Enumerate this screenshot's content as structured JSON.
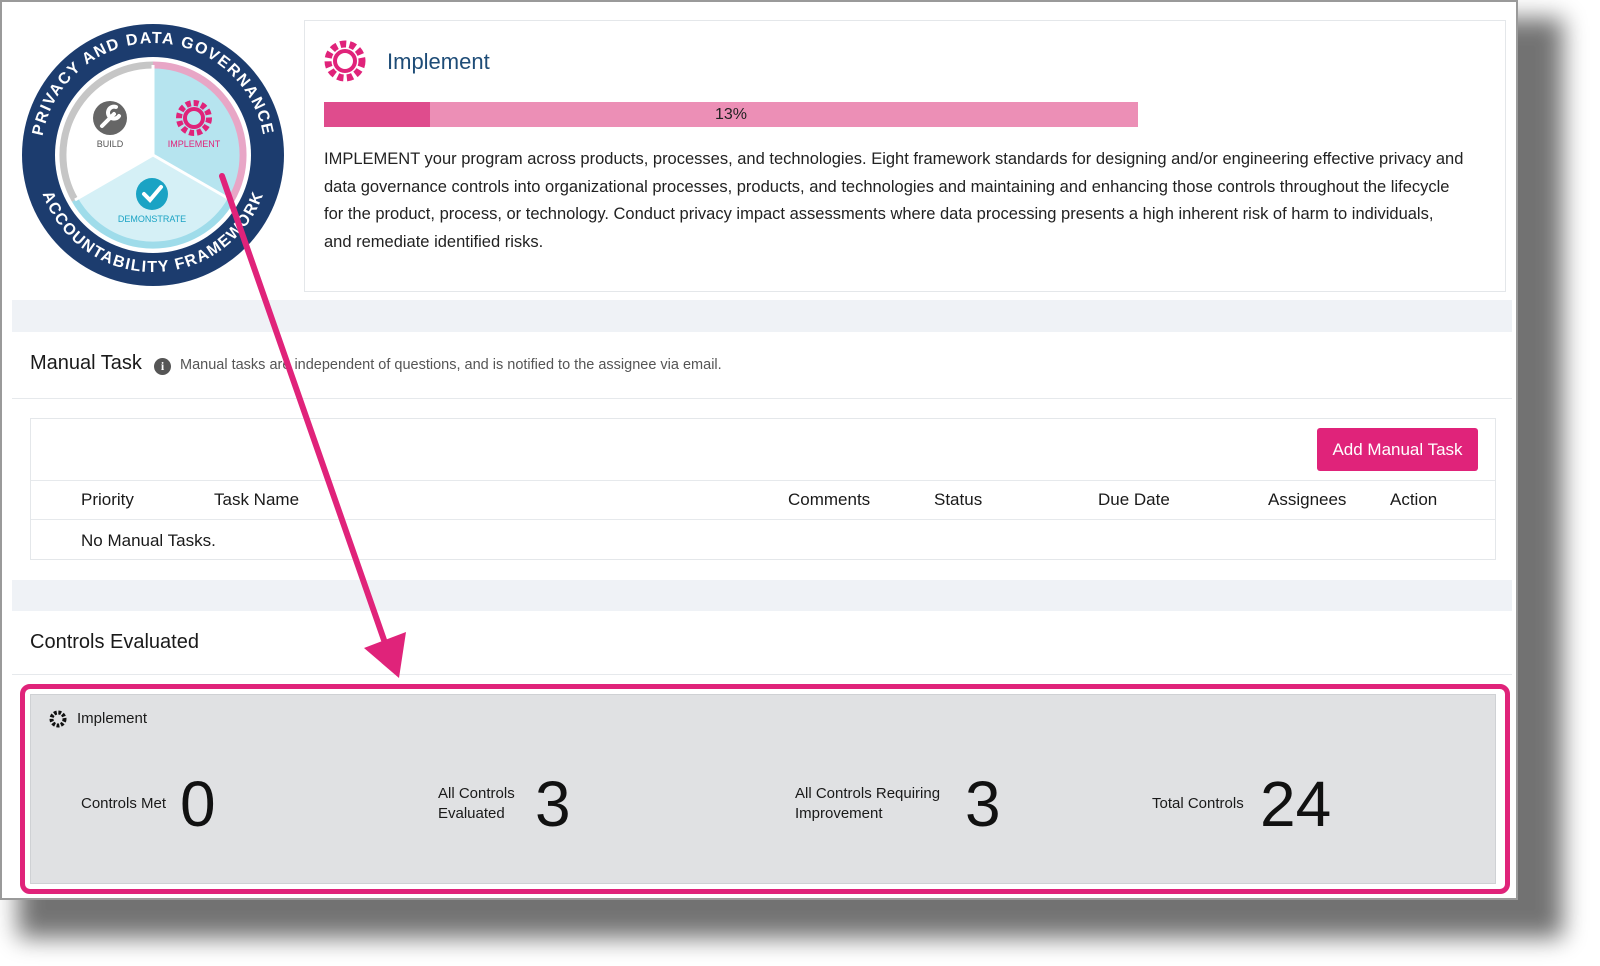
{
  "logo": {
    "ring_top": "PRIVACY AND DATA GOVERNANCE",
    "ring_bottom": "ACCOUNTABILITY FRAMEWORK",
    "segments": [
      "BUILD",
      "IMPLEMENT",
      "DEMONSTRATE"
    ]
  },
  "phase": {
    "title": "Implement",
    "progress": 0.13,
    "progress_label": "13%",
    "description": "IMPLEMENT your program across products, processes, and technologies. Eight framework standards for designing and/or engineering effective privacy and data governance controls into organizational processes, products, and technologies and maintaining and enhancing those controls throughout the lifecycle for the product, process, or technology. Conduct privacy impact assessments where data processing presents a high inherent risk of harm to individuals, and remediate identified risks."
  },
  "manual_task": {
    "title": "Manual Task",
    "hint": "Manual tasks are independent of questions, and is notified to the assignee via email.",
    "add_button": "Add Manual Task",
    "columns": [
      "Priority",
      "Task Name",
      "Comments",
      "Status",
      "Due Date",
      "Assignees",
      "Action"
    ],
    "empty_text": "No Manual Tasks."
  },
  "controls": {
    "title": "Controls Evaluated",
    "group_label": "Implement",
    "stats": [
      {
        "label": "Controls Met",
        "value": "0"
      },
      {
        "label": "All Controls Evaluated",
        "value": "3"
      },
      {
        "label": "All Controls Requiring Improvement",
        "value": "3"
      },
      {
        "label": "Total Controls",
        "value": "24"
      }
    ]
  },
  "colors": {
    "accent": "#e0237a",
    "navy": "#1c3c6e",
    "progress_fill": "#df4c8d",
    "progress_track": "#ec8fb6"
  },
  "icons": [
    "gear-icon",
    "wrench-icon",
    "check-icon",
    "info-icon"
  ]
}
